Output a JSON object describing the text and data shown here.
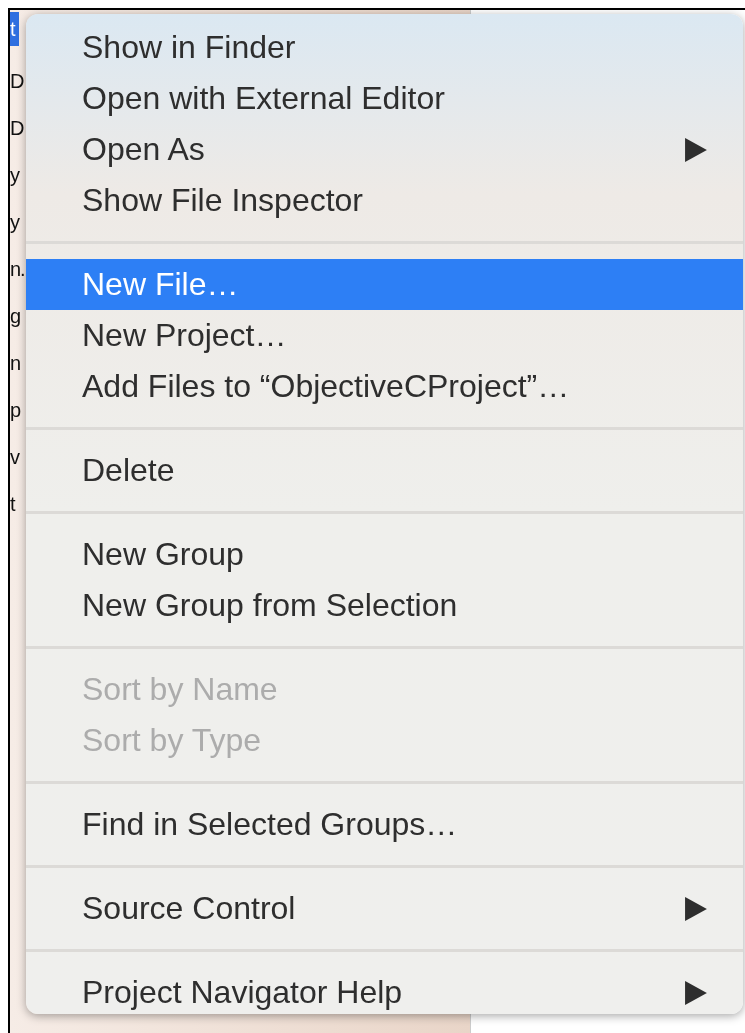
{
  "sidebar": {
    "rows": [
      {
        "text": "t",
        "selected": true
      },
      {
        "text": "D",
        "selected": false
      },
      {
        "text": "D",
        "selected": false
      },
      {
        "text": "y",
        "selected": false
      },
      {
        "text": "y",
        "selected": false
      },
      {
        "text": "n.",
        "selected": false
      },
      {
        "text": "g",
        "selected": false
      },
      {
        "text": "n",
        "selected": false
      },
      {
        "text": "p",
        "selected": false
      },
      {
        "text": "v",
        "selected": false
      },
      {
        "text": "t",
        "selected": false
      }
    ]
  },
  "context_menu": {
    "sections": [
      [
        {
          "label": "Show in Finder",
          "selected": false,
          "disabled": false,
          "submenu": false
        },
        {
          "label": "Open with External Editor",
          "selected": false,
          "disabled": false,
          "submenu": false
        },
        {
          "label": "Open As",
          "selected": false,
          "disabled": false,
          "submenu": true
        },
        {
          "label": "Show File Inspector",
          "selected": false,
          "disabled": false,
          "submenu": false
        }
      ],
      [
        {
          "label": "New File…",
          "selected": true,
          "disabled": false,
          "submenu": false
        },
        {
          "label": "New Project…",
          "selected": false,
          "disabled": false,
          "submenu": false
        },
        {
          "label": "Add Files to “ObjectiveCProject”…",
          "selected": false,
          "disabled": false,
          "submenu": false
        }
      ],
      [
        {
          "label": "Delete",
          "selected": false,
          "disabled": false,
          "submenu": false
        }
      ],
      [
        {
          "label": "New Group",
          "selected": false,
          "disabled": false,
          "submenu": false
        },
        {
          "label": "New Group from Selection",
          "selected": false,
          "disabled": false,
          "submenu": false
        }
      ],
      [
        {
          "label": "Sort by Name",
          "selected": false,
          "disabled": true,
          "submenu": false
        },
        {
          "label": "Sort by Type",
          "selected": false,
          "disabled": true,
          "submenu": false
        }
      ],
      [
        {
          "label": "Find in Selected Groups…",
          "selected": false,
          "disabled": false,
          "submenu": false
        }
      ],
      [
        {
          "label": "Source Control",
          "selected": false,
          "disabled": false,
          "submenu": true
        }
      ],
      [
        {
          "label": "Project Navigator Help",
          "selected": false,
          "disabled": false,
          "submenu": true
        }
      ]
    ]
  }
}
